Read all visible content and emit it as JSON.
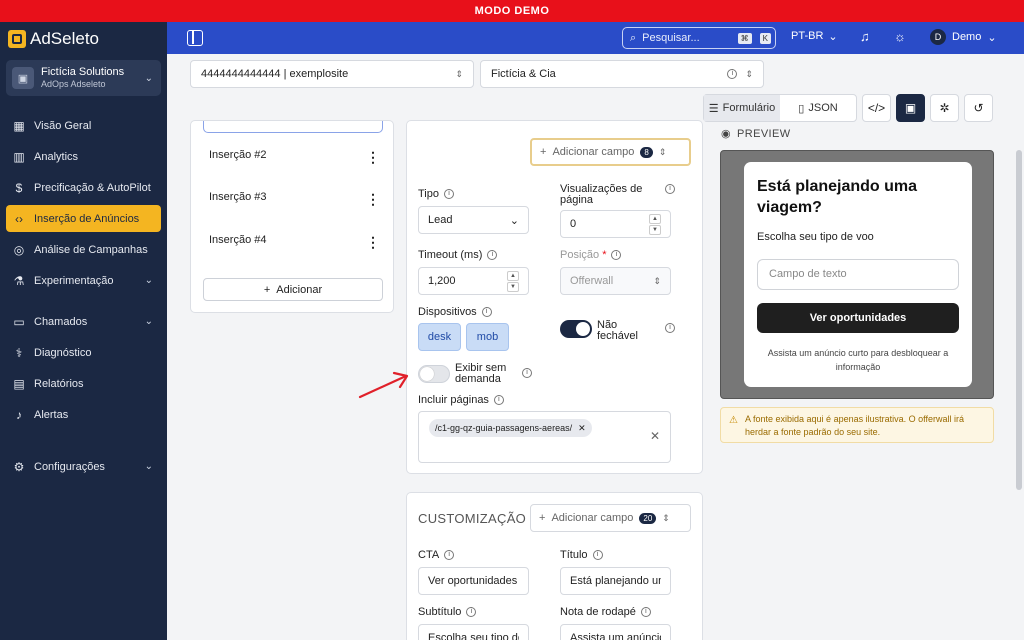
{
  "demo_banner": "MODO DEMO",
  "brand": "AdSeleto",
  "org": {
    "name": "Fictícia Solutions",
    "sub": "AdOps Adseleto"
  },
  "nav": [
    {
      "label": "Visão Geral",
      "icon": "grid-icon",
      "glyph": "▦"
    },
    {
      "label": "Analytics",
      "icon": "bar-chart-icon",
      "glyph": "▥"
    },
    {
      "label": "Precificação & AutoPilot",
      "icon": "dollar-icon",
      "glyph": "$"
    },
    {
      "label": "Inserção de Anúncios",
      "icon": "code-icon",
      "glyph": "‹›",
      "active": true
    },
    {
      "label": "Análise de Campanhas",
      "icon": "target-icon",
      "glyph": "◎"
    },
    {
      "label": "Experimentação",
      "icon": "flask-icon",
      "glyph": "⚗",
      "expand": true
    },
    {
      "label": "Chamados",
      "icon": "ticket-icon",
      "glyph": "▭",
      "expand": true
    },
    {
      "label": "Diagnóstico",
      "icon": "stethoscope-icon",
      "glyph": "⚕"
    },
    {
      "label": "Relatórios",
      "icon": "report-icon",
      "glyph": "▤"
    },
    {
      "label": "Alertas",
      "icon": "bell-icon",
      "glyph": "♪"
    },
    {
      "label": "Configurações",
      "icon": "gear-icon",
      "glyph": "⚙",
      "expand": true
    }
  ],
  "topbar": {
    "search_label": "Pesquisar...",
    "kbd1": "⌘",
    "kbd2": "K",
    "lang": "PT-BR",
    "user_initial": "D",
    "user_name": "Demo"
  },
  "site_select": "4444444444444 | exemplosite",
  "company_select": "Fictícia & Cia",
  "view": {
    "form": "Formulário",
    "json": "JSON"
  },
  "insertions": [
    "Inserção #2",
    "Inserção #3",
    "Inserção #4"
  ],
  "add_insertion": "Adicionar",
  "form": {
    "add_field": "Adicionar campo",
    "add_field_count": "8",
    "tipo_label": "Tipo",
    "tipo_value": "Lead",
    "views_label": "Visualizações de página",
    "views_value": "0",
    "timeout_label": "Timeout (ms)",
    "timeout_value": "1,200",
    "pos_label": "Posição",
    "pos_required": "*",
    "pos_value": "Offerwall",
    "devices_label": "Dispositivos",
    "device_desk": "desk",
    "device_mob": "mob",
    "non_close_label": "Não fechável",
    "on_demand_label": "Exibir sem demanda",
    "pages_label": "Incluir páginas",
    "page_tag": "/c1-gg-qz-guia-passagens-aereas/"
  },
  "custom": {
    "title": "CUSTOMIZAÇÃO",
    "add_field": "Adicionar campo",
    "add_field_count": "20",
    "cta_label": "CTA",
    "cta_value": "Ver oportunidades",
    "titulo_label": "Título",
    "titulo_value": "Está planejando uma viagem?",
    "subtitulo_label": "Subtítulo",
    "subtitulo_value": "Escolha seu tipo de voo",
    "rodape_label": "Nota de rodapé",
    "rodape_value": "Assista um anúncio curto para desbloquear a informação"
  },
  "preview": {
    "label": "PREVIEW",
    "title": "Está planejando uma viagem?",
    "subtitle": "Escolha seu tipo de voo",
    "input_placeholder": "Campo de texto",
    "button": "Ver oportunidades",
    "footer": "Assista um anúncio curto para desbloquear a informação"
  },
  "warning": "A fonte exibida aqui é apenas ilustrativa. O offerwall irá herdar a fonte padrão do seu site.",
  "colors": {
    "demo_red": "#e8101a",
    "sidebar": "#1b2843",
    "topbar": "#2a4cc8",
    "accent": "#f4b521"
  }
}
